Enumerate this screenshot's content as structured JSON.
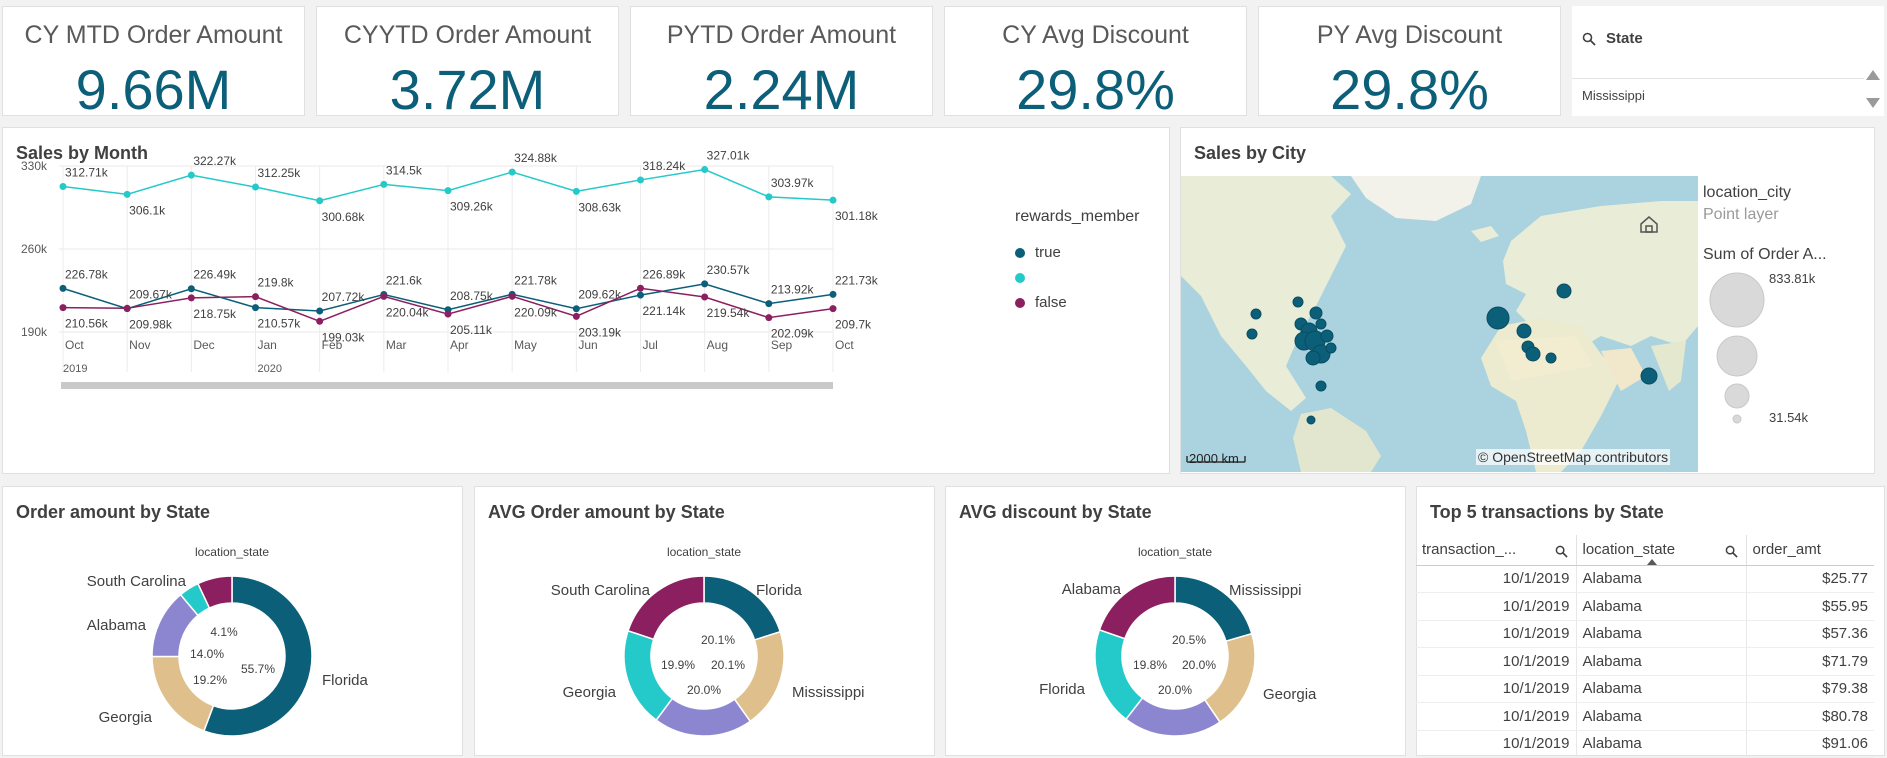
{
  "kpis": [
    {
      "title": "CY MTD Order Amount",
      "value": "9.66M"
    },
    {
      "title": "CYYTD Order Amount",
      "value": "3.72M"
    },
    {
      "title": "PYTD Order Amount",
      "value": "2.24M"
    },
    {
      "title": "CY Avg Discount",
      "value": "29.8%"
    },
    {
      "title": "PY Avg Discount",
      "value": "29.8%"
    }
  ],
  "filter": {
    "title": "State",
    "value": "Mississippi",
    "icon": "search-icon"
  },
  "sales_by_month": {
    "title": "Sales by Month",
    "legend_title": "rewards_member",
    "legend": [
      {
        "label": "true",
        "color": "#0b5f78"
      },
      {
        "label": "",
        "color": "#24c9c9"
      },
      {
        "label": "false",
        "color": "#8c1f5f"
      }
    ],
    "y_ticks": [
      "330k",
      "260k",
      "190k"
    ],
    "years": [
      "2019",
      "2020"
    ]
  },
  "chart_data": [
    {
      "type": "line",
      "title": "Sales by Month",
      "categories": [
        "Oct",
        "Nov",
        "Dec",
        "Jan",
        "Feb",
        "Mar",
        "Apr",
        "May",
        "Jun",
        "Jul",
        "Aug",
        "Sep",
        "Oct"
      ],
      "ylim": [
        190000,
        330000
      ],
      "series": [
        {
          "name": "",
          "color": "#24c9c9",
          "values": [
            312710,
            306100,
            322270,
            312250,
            300680,
            314500,
            309260,
            324880,
            308630,
            318240,
            327010,
            303970,
            301180
          ],
          "labels": [
            "312.71k",
            "306.1k",
            "322.27k",
            "312.25k",
            "300.68k",
            "314.5k",
            "309.26k",
            "324.88k",
            "308.63k",
            "318.24k",
            "327.01k",
            "303.97k",
            "301.18k"
          ]
        },
        {
          "name": "true",
          "color": "#0b5f78",
          "values": [
            226780,
            209670,
            226490,
            210570,
            207720,
            221600,
            208750,
            221780,
            209620,
            221140,
            230570,
            213920,
            221730
          ],
          "labels": [
            "226.78k",
            "209.67k",
            "226.49k",
            "210.57k",
            "207.72k",
            "221.6k",
            "208.75k",
            "221.78k",
            "209.62k",
            "221.14k",
            "230.57k",
            "213.92k",
            "221.73k"
          ]
        },
        {
          "name": "false",
          "color": "#8c1f5f",
          "values": [
            210560,
            209980,
            218750,
            219800,
            199030,
            220040,
            205110,
            220090,
            203190,
            226890,
            219540,
            202090,
            209700
          ],
          "labels": [
            "210.56k",
            "209.98k",
            "218.75k",
            "219.8k",
            "199.03k",
            "220.04k",
            "205.11k",
            "220.09k",
            "203.19k",
            "226.89k",
            "219.54k",
            "202.09k",
            "209.7k"
          ]
        }
      ]
    },
    {
      "type": "pie",
      "title": "Order amount by State",
      "dimension": "location_state",
      "slices": [
        {
          "label": "Florida",
          "value": 55.7,
          "color": "#0b5f78",
          "pct": "55.7%"
        },
        {
          "label": "Georgia",
          "value": 19.2,
          "color": "#dfc08c",
          "pct": "19.2%"
        },
        {
          "label": "Alabama",
          "value": 14.0,
          "color": "#8b86cf",
          "pct": "14.0%"
        },
        {
          "label": "South Carolina",
          "value": 4.1,
          "color": "#24c9c9",
          "pct": "4.1%"
        },
        {
          "label": "",
          "value": 7.0,
          "color": "#8c1f5f",
          "pct": ""
        }
      ]
    },
    {
      "type": "pie",
      "title": "AVG Order amount by State",
      "dimension": "location_state",
      "slices": [
        {
          "label": "Florida",
          "value": 20.1,
          "color": "#0b5f78",
          "pct": "20.1%"
        },
        {
          "label": "Mississippi",
          "value": 20.1,
          "color": "#dfc08c",
          "pct": "20.1%"
        },
        {
          "label": "",
          "value": 20.0,
          "color": "#8b86cf",
          "pct": "20.0%"
        },
        {
          "label": "Georgia",
          "value": 19.9,
          "color": "#24c9c9",
          "pct": "19.9%"
        },
        {
          "label": "South Carolina",
          "value": 19.9,
          "color": "#8c1f5f",
          "pct": ""
        }
      ]
    },
    {
      "type": "pie",
      "title": "AVG discount by State",
      "dimension": "location_state",
      "slices": [
        {
          "label": "Mississippi",
          "value": 20.5,
          "color": "#0b5f78",
          "pct": "20.5%"
        },
        {
          "label": "Georgia",
          "value": 20.0,
          "color": "#dfc08c",
          "pct": "20.0%"
        },
        {
          "label": "",
          "value": 20.0,
          "color": "#8b86cf",
          "pct": "20.0%"
        },
        {
          "label": "Florida",
          "value": 19.8,
          "color": "#24c9c9",
          "pct": "19.8%"
        },
        {
          "label": "Alabama",
          "value": 19.7,
          "color": "#8c1f5f",
          "pct": ""
        }
      ]
    }
  ],
  "map": {
    "title": "Sales by City",
    "layer_name": "location_city",
    "layer_type": "Point layer",
    "size_title": "Sum of Order A...",
    "size_max": "833.81k",
    "size_min": "31.54k",
    "scale": "2000 km",
    "attribution": "© OpenStreetMap contributors"
  },
  "table": {
    "title": "Top 5 transactions by State",
    "columns": [
      "transaction_...",
      "location_state",
      "order_amt"
    ],
    "rows": [
      [
        "10/1/2019",
        "Alabama",
        "$25.77"
      ],
      [
        "10/1/2019",
        "Alabama",
        "$55.95"
      ],
      [
        "10/1/2019",
        "Alabama",
        "$57.36"
      ],
      [
        "10/1/2019",
        "Alabama",
        "$71.79"
      ],
      [
        "10/1/2019",
        "Alabama",
        "$79.38"
      ],
      [
        "10/1/2019",
        "Alabama",
        "$80.78"
      ],
      [
        "10/1/2019",
        "Alabama",
        "$91.06"
      ]
    ]
  }
}
